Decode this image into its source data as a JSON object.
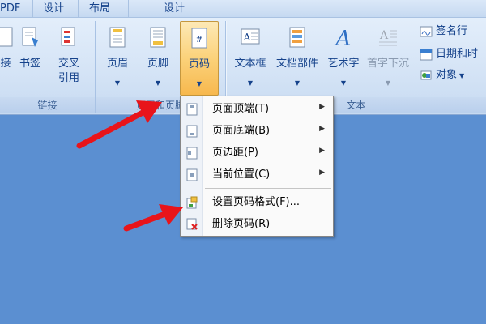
{
  "tabs": {
    "pdf": "PDF",
    "design1": "设计",
    "layout": "布局",
    "design2": "设计"
  },
  "ribbon": {
    "links_group": {
      "label": "链接",
      "buttons": [
        "接",
        "书签",
        "交叉\n引用"
      ]
    },
    "header_group": {
      "label": "页眉和页脚",
      "buttons": [
        "页眉",
        "页脚",
        "页码"
      ]
    },
    "text_group": {
      "label": "文本",
      "buttons": [
        "文本框",
        "文档部件",
        "艺术字",
        "首字下沉"
      ],
      "small": [
        "签名行",
        "日期和时",
        "对象"
      ]
    }
  },
  "menu": {
    "items": [
      {
        "label": "页面顶端(T)",
        "submenu": true
      },
      {
        "label": "页面底端(B)",
        "submenu": true
      },
      {
        "label": "页边距(P)",
        "submenu": true
      },
      {
        "label": "当前位置(C)",
        "submenu": true
      },
      {
        "label": "设置页码格式(F)...",
        "submenu": false
      },
      {
        "label": "删除页码(R)",
        "submenu": false
      }
    ]
  },
  "colors": {
    "document_bg": "#5b8fd1",
    "ribbon_bg": "#d5e4f6",
    "active_button": "#fbd27a",
    "arrow": "#e8141a"
  }
}
